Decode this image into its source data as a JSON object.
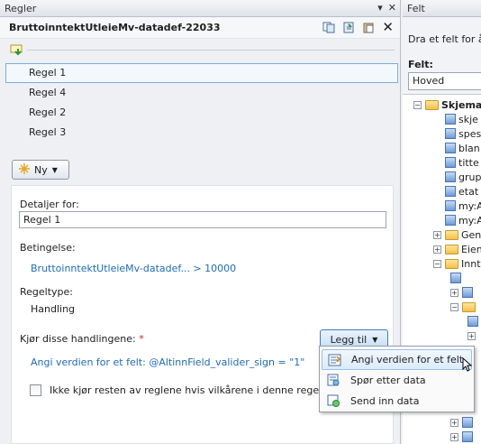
{
  "left_pane": {
    "header_title": "Regler",
    "pin_glyph": "▾",
    "close_glyph": "✕",
    "datadef_title": "BruttoinntektUtleieMv-datadef-22033",
    "close_x": "✕"
  },
  "rules": [
    {
      "label": "Regel 1",
      "selected": true
    },
    {
      "label": "Regel 4",
      "selected": false
    },
    {
      "label": "Regel 2",
      "selected": false
    },
    {
      "label": "Regel 3",
      "selected": false
    }
  ],
  "new_button": {
    "label": "Ny",
    "icon": "sparkle-icon"
  },
  "details": {
    "details_label": "Detaljer for:",
    "details_value": "Regel 1",
    "condition_label": "Betingelse:",
    "condition_value": "BruttoinntektUtleieMv-datadef... > 10000",
    "ruletype_label": "Regeltype:",
    "ruletype_value": "Handling",
    "actions_label": "Kjør disse handlingene:",
    "required_mark": "*",
    "add_button": "Legg til",
    "action_value": "Angi verdien for et felt: @AltinnField_valider_sign = \"1\"",
    "stop_checkbox_label": "Ikke kjør resten av reglene hvis vilkårene i denne regelen ik"
  },
  "dropdown_menu": [
    {
      "label": "Angi verdien for et felt",
      "icon": "set-field-value-icon",
      "highlighted": true
    },
    {
      "label": "Spør etter data",
      "icon": "query-data-icon",
      "highlighted": false
    },
    {
      "label": "Send inn data",
      "icon": "submit-data-icon",
      "highlighted": false
    }
  ],
  "right_pane": {
    "header_title": "Felt",
    "description": "Dra et felt for å l",
    "field_label": "Felt:",
    "field_select_value": "Hoved"
  },
  "tree": [
    {
      "label": "Skjema",
      "type": "folder",
      "expander": "−",
      "bold": true
    },
    {
      "label": "skje",
      "type": "field"
    },
    {
      "label": "spes",
      "type": "field"
    },
    {
      "label": "blan",
      "type": "field"
    },
    {
      "label": "titte",
      "type": "field"
    },
    {
      "label": "grup",
      "type": "field"
    },
    {
      "label": "etat",
      "type": "field"
    },
    {
      "label": "my:A",
      "type": "field"
    },
    {
      "label": "my:A",
      "type": "field"
    },
    {
      "label": "Gen",
      "type": "folder",
      "expander": "+"
    },
    {
      "label": "Eien",
      "type": "folder",
      "expander": "+"
    },
    {
      "label": "Innt",
      "type": "folder",
      "expander": "−"
    }
  ],
  "colors": {
    "accent": "#1e6bb8",
    "selection_border": "#7aaedc",
    "required": "#d2232a"
  }
}
